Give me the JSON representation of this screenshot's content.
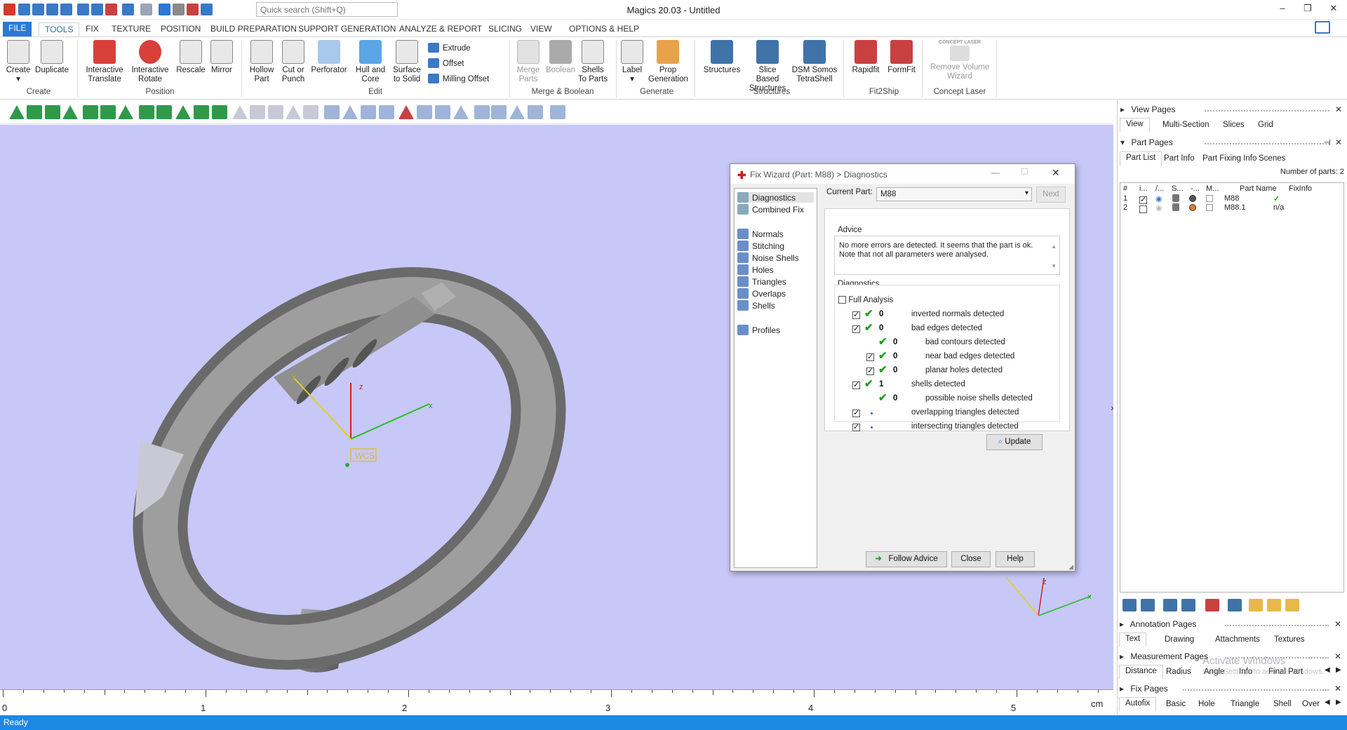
{
  "app": {
    "title": "Magics 20.03 - Untitled",
    "search_placeholder": "Quick search (Shift+Q)",
    "status": "Ready"
  },
  "menu_tabs": [
    "FILE",
    "TOOLS",
    "FIX",
    "TEXTURE",
    "POSITION",
    "BUILD PREPARATION",
    "SUPPORT GENERATION",
    "ANALYZE & REPORT",
    "SLICING",
    "VIEW",
    "OPTIONS & HELP"
  ],
  "ribbon": {
    "create": {
      "create": "Create",
      "duplicate": "Duplicate",
      "group": "Create"
    },
    "position": {
      "interactive_translate": "Interactive Translate",
      "interactive_rotate": "Interactive Rotate",
      "rescale": "Rescale",
      "mirror": "Mirror",
      "group": "Position"
    },
    "edit": {
      "hollow_part": "Hollow Part",
      "cut_or_punch": "Cut or Punch",
      "perforator": "Perforator",
      "hull_and_core": "Hull and Core",
      "surface_to_solid": "Surface to Solid",
      "extrude": "Extrude",
      "offset": "Offset",
      "milling_offset": "Milling Offset",
      "group": "Edit"
    },
    "merge": {
      "merge_parts": "Merge Parts",
      "boolean": "Boolean",
      "shells_to_parts": "Shells To Parts",
      "group": "Merge & Boolean"
    },
    "generate": {
      "label": "Label",
      "prop_generation": "Prop Generation",
      "group": "Generate"
    },
    "structures": {
      "structures": "Structures",
      "slice_based": "Slice Based Structures",
      "dsm_somos": "DSM Somos TetraShell",
      "group": "Structures"
    },
    "fit2ship": {
      "rapidfit": "Rapidfit",
      "formfit": "FormFit",
      "group": "Fit2Ship"
    },
    "concept_laser": {
      "logo": "CONCEPT LASER",
      "remove_volume": "Remove Volume Wizard",
      "group": "Concept Laser"
    }
  },
  "viewport": {
    "wcs_label": "WCS",
    "axes": {
      "x": "x",
      "y": "y",
      "z": "z"
    },
    "ruler_labels": [
      "0",
      "1",
      "2",
      "3",
      "4",
      "5"
    ],
    "ruler_unit": "cm"
  },
  "dialog": {
    "title": "Fix Wizard (Part: M88) > Diagnostics",
    "nav_top": [
      "Diagnostics",
      "Combined Fix"
    ],
    "nav_mid": [
      "Normals",
      "Stitching",
      "Noise Shells",
      "Holes",
      "Triangles",
      "Overlaps",
      "Shells"
    ],
    "nav_bottom": [
      "Profiles"
    ],
    "current_part_label": "Current Part:",
    "current_part_value": "M88",
    "next_label": "Next",
    "advice_title": "Advice",
    "advice_text": "No more errors are detected. It seems that the part is ok.\nNote that not all parameters were analysed.",
    "diagnostics_title": "Diagnostics",
    "full_analysis_label": "Full Analysis",
    "items": [
      {
        "checkbox": true,
        "ok": true,
        "count": "0",
        "label": "inverted normals detected",
        "indent": 0
      },
      {
        "checkbox": true,
        "ok": true,
        "count": "0",
        "label": "bad edges detected",
        "indent": 0
      },
      {
        "checkbox": false,
        "ok": true,
        "count": "0",
        "label": "bad contours detected",
        "indent": 1
      },
      {
        "checkbox": true,
        "ok": true,
        "count": "0",
        "label": "near bad edges detected",
        "indent": 1
      },
      {
        "checkbox": true,
        "ok": true,
        "count": "0",
        "label": "planar holes detected",
        "indent": 1
      },
      {
        "checkbox": true,
        "ok": true,
        "count": "1",
        "label": "shells detected",
        "indent": 0
      },
      {
        "checkbox": false,
        "ok": true,
        "count": "0",
        "label": "possible noise shells detected",
        "indent": 1
      },
      {
        "checkbox": true,
        "ok": false,
        "count": "",
        "label": "overlapping triangles detected",
        "indent": 0
      },
      {
        "checkbox": true,
        "ok": false,
        "count": "",
        "label": "intersecting triangles detected",
        "indent": 0
      }
    ],
    "update_label": "Update",
    "follow_advice_label": "Follow Advice",
    "close_label": "Close",
    "help_label": "Help"
  },
  "right_panel": {
    "view_pages": {
      "title": "View Pages",
      "tabs": [
        "View",
        "Multi-Section",
        "Slices",
        "Grid"
      ]
    },
    "part_pages": {
      "title": "Part Pages",
      "tabs": [
        "Part List",
        "Part Info",
        "Part Fixing Info",
        "Scenes"
      ],
      "number_of_parts": "Number of parts: 2",
      "columns": [
        "#",
        "i...",
        "/...",
        "S...",
        "-...",
        "M...",
        "Part Name",
        "FixInfo"
      ],
      "rows": [
        {
          "num": "1",
          "selected": true,
          "name": "M88",
          "fixinfo": "✓",
          "color": "#555555"
        },
        {
          "num": "2",
          "selected": false,
          "name": "M88.1",
          "fixinfo": "n/a",
          "color": "#e87a2b"
        }
      ]
    },
    "annotation_pages": {
      "title": "Annotation Pages",
      "tabs": [
        "Text",
        "Drawing",
        "Attachments",
        "Textures"
      ]
    },
    "measurement_pages": {
      "title": "Measurement Pages",
      "tabs": [
        "Distance",
        "Radius",
        "Angle",
        "Info",
        "Final Part"
      ]
    },
    "fix_pages": {
      "title": "Fix Pages",
      "tabs": [
        "Autofix",
        "Basic",
        "Hole",
        "Triangle",
        "Shell",
        "Over"
      ]
    },
    "watermark": {
      "line1": "Activate Windows",
      "line2": "Go to Settings to activate Windows."
    }
  },
  "colors": {
    "accent": "#2b79d6",
    "status_bar": "#1e88e5",
    "viewport_bg": "#c7c8f7",
    "ok_green": "#1ea01e"
  }
}
